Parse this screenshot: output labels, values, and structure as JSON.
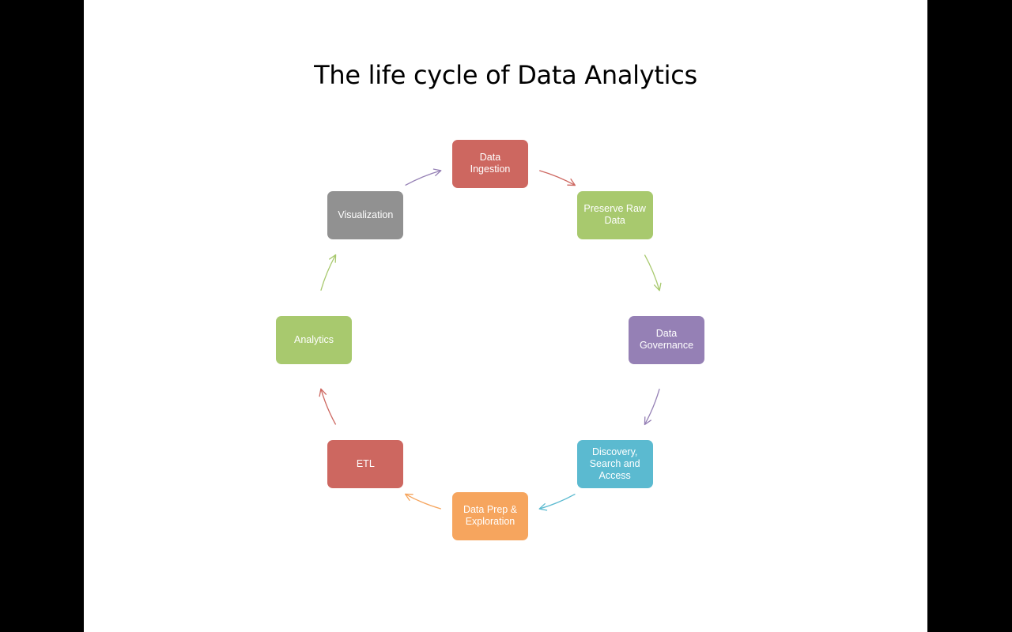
{
  "title": "The life cycle of Data Analytics",
  "nodes": [
    {
      "id": "data-ingestion",
      "label": "Data\nIngestion",
      "color": "#CD6760"
    },
    {
      "id": "preserve-raw-data",
      "label": "Preserve Raw\nData",
      "color": "#A8C96E"
    },
    {
      "id": "data-governance",
      "label": "Data\nGovernance",
      "color": "#9580B5"
    },
    {
      "id": "discovery-search-access",
      "label": "Discovery,\nSearch and\nAccess",
      "color": "#5BBAD0"
    },
    {
      "id": "data-prep-exploration",
      "label": "Data Prep &\nExploration",
      "color": "#F6A55E"
    },
    {
      "id": "etl",
      "label": "ETL",
      "color": "#CD6760"
    },
    {
      "id": "analytics",
      "label": "Analytics",
      "color": "#A8C96E"
    },
    {
      "id": "visualization",
      "label": "Visualization",
      "color": "#919191"
    }
  ],
  "edges": [
    {
      "from": "data-ingestion",
      "to": "preserve-raw-data",
      "color": "#CD6760"
    },
    {
      "from": "preserve-raw-data",
      "to": "data-governance",
      "color": "#A8C96E"
    },
    {
      "from": "data-governance",
      "to": "discovery-search-access",
      "color": "#9580B5"
    },
    {
      "from": "discovery-search-access",
      "to": "data-prep-exploration",
      "color": "#5BBAD0"
    },
    {
      "from": "data-prep-exploration",
      "to": "etl",
      "color": "#F6A55E"
    },
    {
      "from": "etl",
      "to": "analytics",
      "color": "#CD6760"
    },
    {
      "from": "analytics",
      "to": "visualization",
      "color": "#A8C96E"
    },
    {
      "from": "visualization",
      "to": "data-ingestion",
      "color": "#9580B5"
    }
  ]
}
